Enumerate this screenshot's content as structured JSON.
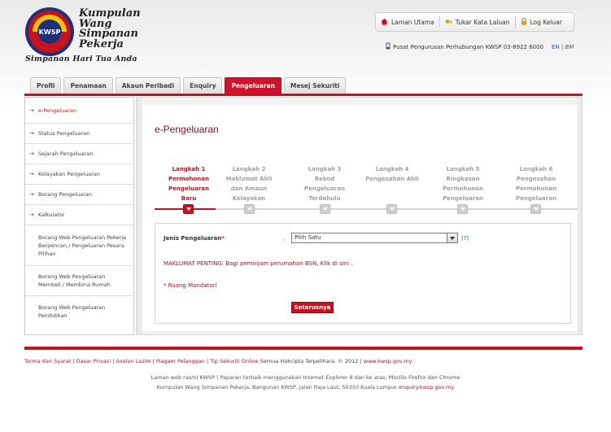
{
  "logo": {
    "lines": [
      "Kumpulan",
      "Wang",
      "Simpanan",
      "Pekerja"
    ],
    "emblem_text": "KWSP",
    "tagline": "Simpanan Hari Tua Anda"
  },
  "top_links": [
    {
      "label": "Laman Utama",
      "icon": "home-icon"
    },
    {
      "label": "Tukar Kata Laluan",
      "icon": "key-icon"
    },
    {
      "label": "Log Keluar",
      "icon": "lock-icon"
    }
  ],
  "contact": {
    "text": "Pusat Pengurusan Perhubungan KWSP 03-8922 6000",
    "lang_en": "EN",
    "lang_sep": "|",
    "lang_bm": "BM"
  },
  "tabs": [
    {
      "label": "Profil",
      "active": false
    },
    {
      "label": "Penamaan",
      "active": false
    },
    {
      "label": "Akaun Peribadi",
      "active": false
    },
    {
      "label": "Enquiry",
      "active": false
    },
    {
      "label": "Pengeluaran",
      "active": true
    },
    {
      "label": "Mesej Sekuriti",
      "active": false
    }
  ],
  "sidebar": {
    "items": [
      {
        "label": "e-Pengeluaran",
        "active": true
      },
      {
        "label": "Status Pengeluaran",
        "active": false
      },
      {
        "label": "Sejarah Pengeluaran",
        "active": false
      },
      {
        "label": "Kelayakan Pengeluaran",
        "active": false
      },
      {
        "label": "Borang Pengeluaran",
        "active": false
      },
      {
        "label": "Kalkulator",
        "active": false
      },
      {
        "label": "Borang Web Pengeluaran Pekerja Berpencen / Pengeluaran Pesara Pilihan",
        "active": false
      },
      {
        "label": "Borang Web Pengeluaran Membeli / Membina Rumah",
        "active": false
      },
      {
        "label": "Borang Web Pengeluaran Pendidikan",
        "active": false
      }
    ]
  },
  "main": {
    "title": "e-Pengeluaran",
    "steps": [
      {
        "lines": [
          "Langkah 1",
          "Permohonan",
          "Pengeluaran Baru"
        ],
        "active": true
      },
      {
        "lines": [
          "Langkah 2",
          "Maklumat Ahli",
          "dan Amaun",
          "Kelayakan"
        ],
        "active": false
      },
      {
        "lines": [
          "Langkah 3",
          "Rekod Pengeluaran",
          "Terdahulu"
        ],
        "active": false
      },
      {
        "lines": [
          "Langkah 4",
          "Pengesahan Ahli"
        ],
        "active": false
      },
      {
        "lines": [
          "Langkah 5",
          "Ringkasan",
          "Permohonan",
          "Pengeluaran"
        ],
        "active": false
      },
      {
        "lines": [
          "Langkah 6",
          "Pengesahan",
          "Permohonan",
          "Pengeluaran"
        ],
        "active": false
      }
    ],
    "form": {
      "field_label": "Jenis Pengeluaran",
      "required_mark": "*",
      "colon": ":",
      "select_value": "Pilih Satu",
      "help": "(?)",
      "notice": "MAKLUMAT PENTING: Bagi peminjam perumahan BSN, Klik di sini .",
      "mandatory": "* Ruang Mandatori",
      "submit_label": "Seterusnya"
    }
  },
  "footer": {
    "links": [
      "Terma dan Syarat",
      "Dasar Privasi",
      "Soalan Lazim",
      "Piagam Pelanggan",
      "Tip Sekuriti Online"
    ],
    "copyright": "Semua Hakcipta Terpelihara. © 2012 |",
    "site": "www.kwsp.gov.my",
    "info_line1": "Laman web rasmi KWSP | Paparan terbaik menggunakan Internet Explorer 8 dan ke atas, Mozilla Firefox dan Chrome",
    "info_line2": "Kumpulan Wang Simpanan Pekerja, Bangunan KWSP, Jalan Raja Laut, 50350 Kuala Lumpur",
    "enquiry": "enquiry.kwsp.gov.my"
  },
  "colors": {
    "brand_red": "#c8101e",
    "title_maroon": "#8a1022",
    "link_blue": "#2a52a8"
  }
}
